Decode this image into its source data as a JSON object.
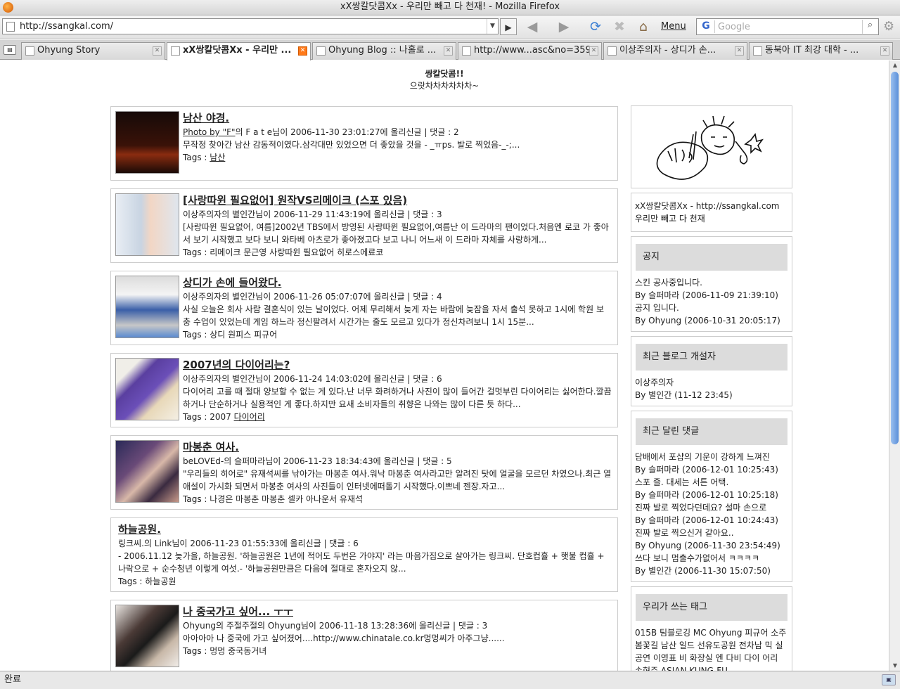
{
  "window": {
    "title": "xX쌍칼닷콤Xx - 우리만 빼고 다 천재! - Mozilla Firefox"
  },
  "toolbar": {
    "url": "http://ssangkal.com/",
    "menu_label": "Menu",
    "search_placeholder": "Google"
  },
  "tabs": [
    {
      "label": "Ohyung Story",
      "active": false
    },
    {
      "label": "xX쌍칼닷콤Xx - 우리만 ...",
      "active": true
    },
    {
      "label": "Ohyung Blog :: 나홀로 ...",
      "active": false
    },
    {
      "label": "http://www...asc&no=359",
      "active": false
    },
    {
      "label": "이상주의자 - 상디가 손...",
      "active": false
    },
    {
      "label": "동북아 IT 최강 대학 - ...",
      "active": false
    }
  ],
  "site": {
    "title": "쌍칼닷콤!!",
    "subtitle": "으랏차차차차차차~"
  },
  "posts": [
    {
      "title": "남산 야경.",
      "meta_link": "Photo by \"F\"",
      "meta": "의 F a t e님이 2006-11-30 23:01:27에 올리신글 | 댓글 : 2",
      "summary": "무작정 찾아간 남산 감동적이였다.삼각대만 있었으면 더 좋았을 것을 - _ㅠps. 발로 찍었음-_-;...",
      "tags_label": "Tags : ",
      "tags": "남산"
    },
    {
      "title": "[사랑따윈 필요없어] 원작VS리메이크 (스포 있음)",
      "meta": "이상주의자의 별인간님이 2006-11-29 11:43:19에 올리신글 | 댓글 : 3",
      "summary": "[사랑따윈 필요없어, 여름]2002년 TBS에서 방영된 사랑따윈 필요없어,여름난 이 드라마의 팬이었다.처음엔 로코 가 좋아서 보기 시작했고 보다 보니 와타베 아츠로가 좋아졌고다 보고 나니 어느새 이 드라마 자체를 사랑하게...",
      "tags_label": "Tags : ",
      "tags": "리메이크 문근영 사랑따윈 필요없어 히로스에료코"
    },
    {
      "title": "상디가 손에 들어왔다.",
      "meta": "이상주의자의 별인간님이 2006-11-26 05:07:07에 올리신글 | 댓글 : 4",
      "summary": "사실 오늘은 회사 사람 결혼식이 있는 날이었다. 어제 무리해서 늦게 자는 바람에 늦잠을 자서 출석 못하고 1시에 학원 보충 수업이 있었는데 게임 하느라 정신팔려서 시간가는 줄도 모르고 있다가 정신차려보니 1시 15분...",
      "tags_label": "Tags : ",
      "tags": "상디 원피스 피규어"
    },
    {
      "title": "2007년의 다이어리는?",
      "meta": "이상주의자의 별인간님이 2006-11-24 14:03:02에 올리신글 | 댓글 : 6",
      "summary": "다이어리 고를 때 절대 양보할 수 없는 게 있다.난 너무 화려하거나 사진이 많이 들어간 걸멋부린 다이어리는 싫어한다.깔끔하거나 단순하거나 실용적인 게 좋다.하지만 요새 소비자들의 취향은 나와는 많이 다른 듯 하다...",
      "tags_label": "Tags : 2007 ",
      "tags": "다이어리"
    },
    {
      "title": "마봉춘 여사.",
      "meta": "beLOVEd-의 슬퍼마라님이 2006-11-23 18:34:43에 올리신글 | 댓글 : 5",
      "summary": "\"우리들의 히어로\" 유재석씨를 낚아가는 마봉춘 여사.워낙 마봉춘 여사라고만 알려진 탓에 얼굴을 모르던 차였으나.최근 열애설이 가시화 되면서 마봉춘 여사의 사진들이 인터넷에떠돌기 시작했다.이쁘네 젠장.자고...",
      "tags_label": "Tags : ",
      "tags": "나경은 마봉춘 마봉춘 셀카 아나운서 유재석"
    },
    {
      "title": "하늘공원.",
      "meta": "링크씨.의 Link님이 2006-11-23 01:55:33에 올리신글 | 댓글 : 6",
      "summary": "- 2006.11.12 늦가을, 하늘공원.  '하늘공원은 1년에 적어도 두번은 가야지' 라는 마음가짐으로 살아가는 링크씨.  단호컵휼 + 햇불 컵휼 + 나락으로 + 순수청년 이렇게 여섯.- '하늘공원만큼은 다음에 절대로 혼자오지 않...",
      "tags_label": "Tags : ",
      "tags": "하늘공원"
    },
    {
      "title": "나 중국가고 싶어... ㅜㅜ",
      "meta": "Ohyung의 주절주절의 Ohyung님이 2006-11-18 13:28:36에 올리신글 | 댓글 : 3",
      "summary": "아아아아 나 중국에 가고 싶어졌어....http://www.chinatale.co.kr멍멍씨가 아주그냥......",
      "tags_label": "Tags : ",
      "tags": "멍멍 중국동거녀"
    }
  ],
  "sidebar": {
    "site_line1": "xX쌍칼닷콤Xx - http://ssangkal.com",
    "site_line2": "우리만 빼고 다 천재",
    "notice": {
      "title": "공지",
      "items": [
        {
          "text": "스킨 공사중입니다.",
          "by": "By 슬퍼마라 (2006-11-09 21:39:10)"
        },
        {
          "text": "공지 입니다.",
          "by": "By Ohyung (2006-10-31 20:05:17)"
        }
      ]
    },
    "recent_bloggers": {
      "title": "최근 블로그 개설자",
      "items": [
        {
          "text": "이상주의자",
          "by": "By 별인간 (11-12 23:45)"
        }
      ]
    },
    "recent_comments": {
      "title": "최근 달린 댓글",
      "items": [
        {
          "text": "담배에서 포샵의 기운이 강하게 느껴진",
          "by": "By 슬퍼마라 (2006-12-01 10:25:43)"
        },
        {
          "text": "스포 즐. 대세는 서튼 어택.",
          "by": "By 슬퍼마라 (2006-12-01 10:25:18)"
        },
        {
          "text": "진짜 발로 찍었다던데요? 설마 손으로",
          "by": "By 슬퍼마라 (2006-12-01 10:24:43)"
        },
        {
          "text": "진짜 발로 찍으신거 같아요..",
          "by": "By Ohyung (2006-11-30 23:54:49)"
        },
        {
          "text": "쓰다 보니 멈출수가없어서 ㅋㅋㅋㅋ",
          "by": "By 별인간 (2006-11-30 15:07:50)"
        }
      ]
    },
    "tags_box": {
      "title": "우리가 쓰는 태그",
      "text": "015B 팀블로깅 MC Ohyung 피규어 소주 봄꽃길 남산 일드 선유도공원 전차남 믹 실 공연 이영표 비 화장실 엔 다비 다이 어리 손현주 ASIAN KUNG-FU"
    }
  },
  "status": {
    "text": "완료"
  }
}
